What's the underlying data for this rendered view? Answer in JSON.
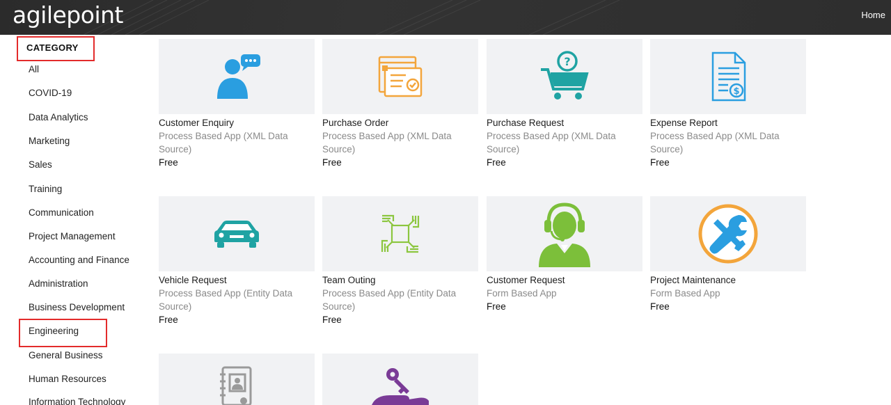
{
  "header": {
    "logo_text": "agilepoint",
    "home_label": "Home"
  },
  "sidebar": {
    "title": "CATEGORY",
    "items": [
      {
        "label": "All"
      },
      {
        "label": "COVID-19"
      },
      {
        "label": "Data Analytics"
      },
      {
        "label": "Marketing"
      },
      {
        "label": "Sales"
      },
      {
        "label": "Training"
      },
      {
        "label": "Communication"
      },
      {
        "label": "Project Management"
      },
      {
        "label": "Accounting and Finance"
      },
      {
        "label": "Administration"
      },
      {
        "label": "Business Development"
      },
      {
        "label": "Engineering"
      },
      {
        "label": "General Business"
      },
      {
        "label": "Human Resources"
      },
      {
        "label": "Information Technology"
      }
    ]
  },
  "apps": [
    {
      "title": "Customer Enquiry",
      "type_line1": "Process Based App (XML Data",
      "type_line2": "Source)",
      "price": "Free",
      "icon": "customer-enquiry-icon",
      "color": "#2a9ee0"
    },
    {
      "title": "Purchase Order",
      "type_line1": "Process Based App (XML Data",
      "type_line2": "Source)",
      "price": "Free",
      "icon": "purchase-order-icon",
      "color": "#f3a53b"
    },
    {
      "title": "Purchase Request",
      "type_line1": "Process Based App (XML Data",
      "type_line2": "Source)",
      "price": "Free",
      "icon": "shopping-cart-question-icon",
      "color": "#1fa3a3"
    },
    {
      "title": "Expense Report",
      "type_line1": "Process Based App (XML Data",
      "type_line2": "Source)",
      "price": "Free",
      "icon": "expense-report-icon",
      "color": "#2a9ee0"
    },
    {
      "title": "Vehicle Request",
      "type_line1": "Process Based App (Entity Data",
      "type_line2": "Source)",
      "price": "Free",
      "icon": "car-icon",
      "color": "#1fa3a3"
    },
    {
      "title": "Team Outing",
      "type_line1": "Process Based App (Entity Data",
      "type_line2": "Source)",
      "price": "Free",
      "icon": "team-hands-icon",
      "color": "#8cc63f"
    },
    {
      "title": "Customer Request",
      "type_line1": "Form Based App",
      "type_line2": "",
      "price": "Free",
      "icon": "support-agent-icon",
      "color": "#7cbf3a"
    },
    {
      "title": "Project Maintenance",
      "type_line1": "Form Based App",
      "type_line2": "",
      "price": "Free",
      "icon": "tools-icon",
      "color": "#f3a53b"
    },
    {
      "title": "",
      "type_line1": "",
      "type_line2": "",
      "price": "",
      "icon": "employee-directory-icon",
      "color": "#9a9a9a"
    },
    {
      "title": "",
      "type_line1": "",
      "type_line2": "",
      "price": "",
      "icon": "key-hand-icon",
      "color": "#7a3b96"
    }
  ]
}
